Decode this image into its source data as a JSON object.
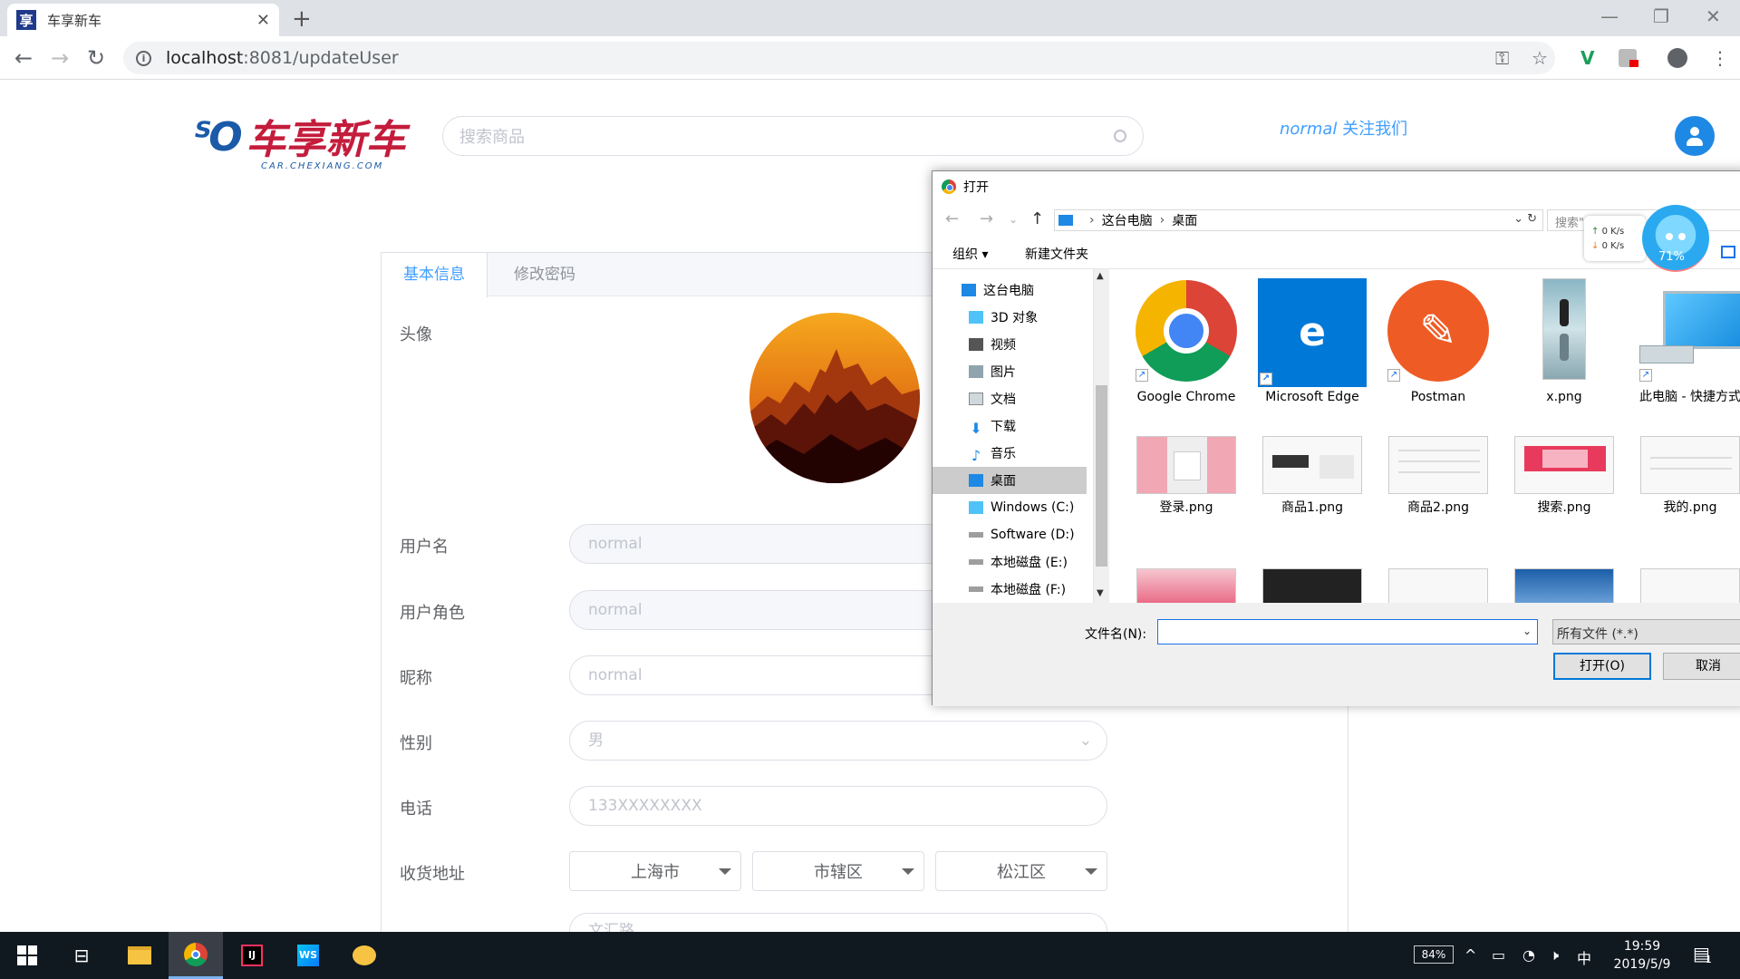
{
  "browser": {
    "tab_title": "车享新车",
    "tab_favicon_char": "享",
    "url_host": "localhost",
    "url_path": ":8081/updateUser"
  },
  "header": {
    "logo_name": "车享新车",
    "logo_sub": "CAR.CHEXIANG.COM",
    "search_placeholder": "搜索商品",
    "username": "normal",
    "follow_label": "关注我们"
  },
  "profile": {
    "tabs": [
      "基本信息",
      "修改密码"
    ],
    "avatar_label": "头像",
    "fields": [
      {
        "label": "用户名",
        "value": "normal"
      },
      {
        "label": "用户角色",
        "value": "normal"
      },
      {
        "label": "昵称",
        "value": "normal"
      },
      {
        "label": "性别",
        "value": "男"
      },
      {
        "label": "电话",
        "value": "133XXXXXXXX"
      }
    ],
    "address_label": "收货地址",
    "address": {
      "province": "上海市",
      "city": "市辖区",
      "district": "松江区",
      "street": "文汇路"
    }
  },
  "dialog": {
    "title": "打开",
    "breadcrumb": [
      "这台电脑",
      "桌面"
    ],
    "search_placeholder": "搜索\"桌...",
    "organize_label": "组织 ▾",
    "new_folder_label": "新建文件夹",
    "tree": [
      "这台电脑",
      "3D 对象",
      "视频",
      "图片",
      "文档",
      "下载",
      "音乐",
      "桌面",
      "Windows (C:)",
      "Software (D:)",
      "本地磁盘 (E:)",
      "本地磁盘 (F:)"
    ],
    "files_row1": [
      "Google Chrome",
      "Microsoft Edge",
      "Postman",
      "x.png",
      "此电脑 - 快捷方式"
    ],
    "files_row2": [
      "登录.png",
      "商品1.png",
      "商品2.png",
      "搜索.png",
      "我的.png"
    ],
    "filename_label": "文件名(N):",
    "filetype": "所有文件 (*.*)",
    "open_label": "打开(O)",
    "cancel_label": "取消"
  },
  "net_widget": {
    "up": "0  K/s",
    "down": "0  K/s",
    "percent": "71%"
  },
  "taskbar": {
    "battery": "84%",
    "ime": "中",
    "time": "19:59",
    "date": "2019/5/9",
    "notif_count": "1"
  },
  "colors": {
    "brand_blue": "#409eff",
    "brand_red": "#c41c3c",
    "taskbar": "#101820"
  }
}
